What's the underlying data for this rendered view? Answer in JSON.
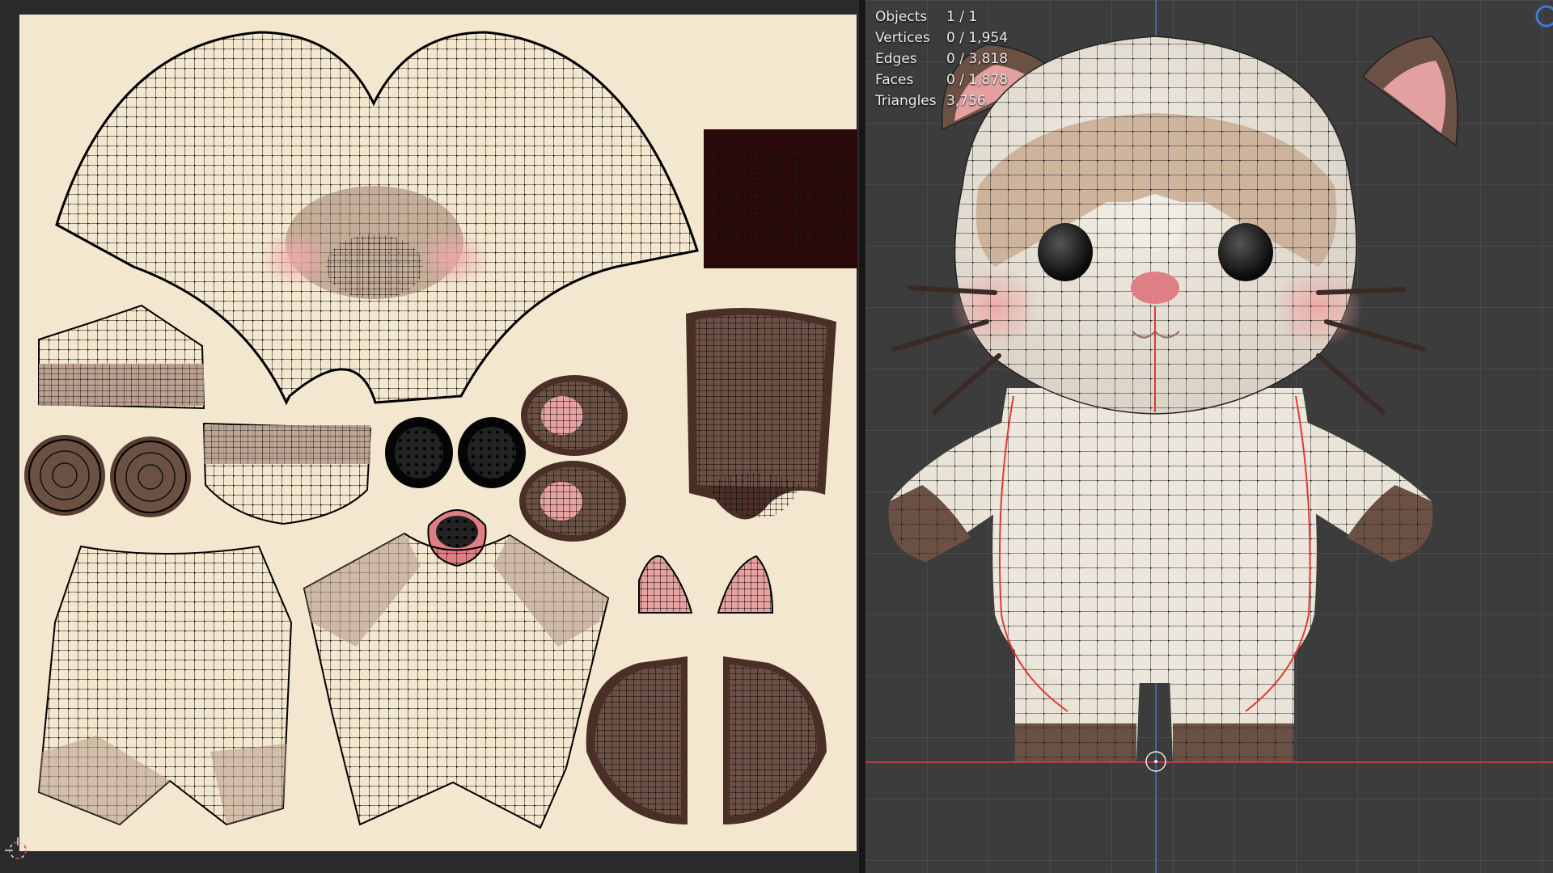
{
  "viewport": {
    "stats": [
      {
        "label": "Objects",
        "value": "1 / 1"
      },
      {
        "label": "Vertices",
        "value": "0 / 1,954"
      },
      {
        "label": "Edges",
        "value": "0 / 3,818"
      },
      {
        "label": "Faces",
        "value": "0 / 1,878"
      },
      {
        "label": "Triangles",
        "value": "3,756"
      }
    ]
  },
  "colors": {
    "uv_background": "#f3e8cf",
    "fur_brown": "#6b5044",
    "mask_tan": "#c9ab92",
    "cheek_pink": "#e6a1a1",
    "body_white": "#efe9df",
    "wire": "#111111",
    "seam_red": "#e23a2e"
  },
  "icons": [
    "cursor-icon",
    "origin-icon",
    "navigation-gizmo-icon"
  ]
}
